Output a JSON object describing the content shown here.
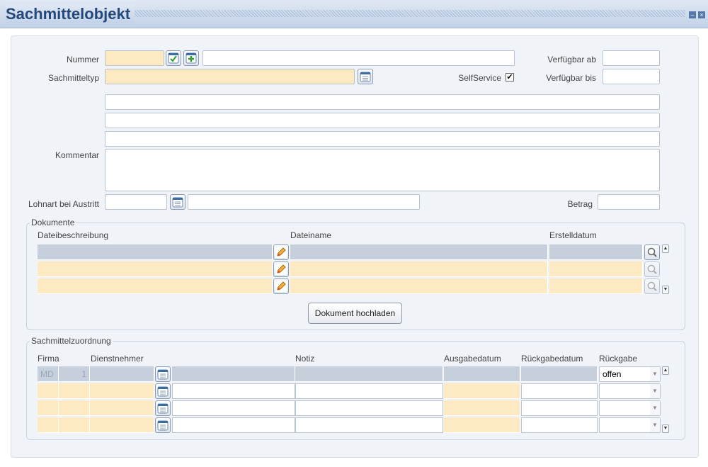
{
  "window": {
    "title": "Sachmittelobjekt",
    "minimize_glyph": "–",
    "close_glyph": "×"
  },
  "form": {
    "nummer_label": "Nummer",
    "sachmitteltyp_label": "Sachmitteltyp",
    "selfservice_label": "SelfService",
    "selfservice_checked": true,
    "verfuegbar_ab_label": "Verfügbar ab",
    "verfuegbar_bis_label": "Verfügbar bis",
    "kommentar_label": "Kommentar",
    "lohnart_label": "Lohnart bei Austritt",
    "betrag_label": "Betrag"
  },
  "dokumente": {
    "title": "Dokumente",
    "columns": [
      "Dateibeschreibung",
      "Dateiname",
      "Erstelldatum"
    ],
    "upload_button": "Dokument hochladen"
  },
  "zuordnung": {
    "title": "Sachmittelzuordnung",
    "columns": [
      "Firma",
      "Dienstnehmer",
      "Notiz",
      "Ausgabedatum",
      "Rückgabedatum",
      "Rückgabe"
    ],
    "rows": [
      {
        "firma": "MD",
        "nr": "1",
        "rueckgabe": "offen"
      },
      {
        "firma": "",
        "nr": "",
        "rueckgabe": ""
      },
      {
        "firma": "",
        "nr": "",
        "rueckgabe": ""
      },
      {
        "firma": "",
        "nr": "",
        "rueckgabe": ""
      }
    ]
  },
  "icons": {
    "calendar": "calendar-icon",
    "check": "check-icon",
    "add": "add-icon",
    "edit": "pencil-icon",
    "search": "magnifier-icon"
  },
  "colors": {
    "required": "#fde9c2",
    "selected_row": "#c6cfdc",
    "title": "#25477a"
  }
}
